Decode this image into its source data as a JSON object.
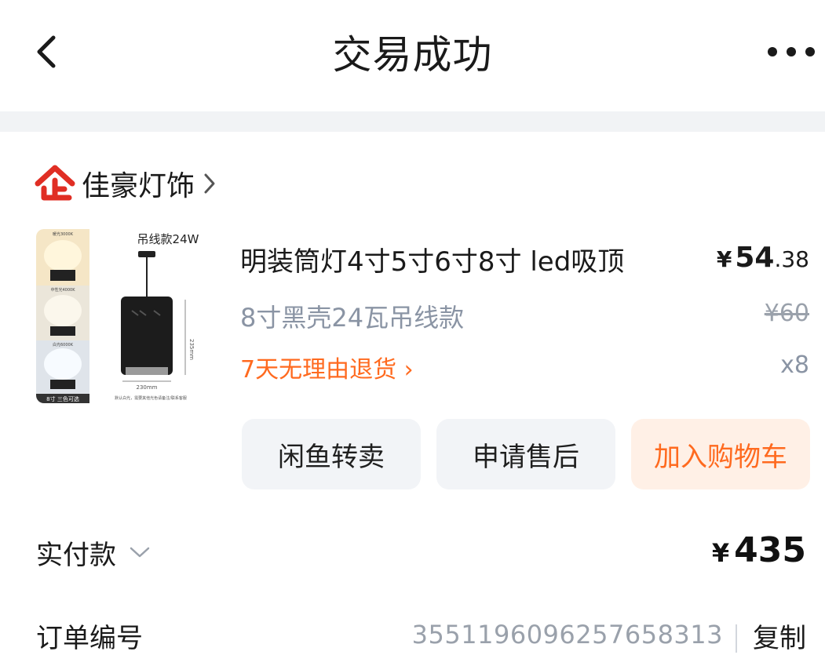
{
  "header": {
    "title": "交易成功",
    "back_icon": "chevron-left-icon",
    "more_icon": "more-horizontal-icon"
  },
  "shop": {
    "name": "佳豪灯饰",
    "logo_icon": "enterprise-badge-icon",
    "logo_color": "#e02e24"
  },
  "product": {
    "title": "明装筒灯4寸5寸6寸8寸 led吸顶",
    "price_symbol": "¥",
    "price_int": "54",
    "price_dec": ".38",
    "spec": "8寸黑壳24瓦吊线款",
    "original_price": "¥60",
    "return_policy": "7天无理由退货 ›",
    "quantity": "x8",
    "image": {
      "label_top": "吊线款24W",
      "swatch_labels": [
        "暖光3000K",
        "中性光4000K",
        "白光6000K"
      ],
      "caption": "8寸 三色可选",
      "dim_width": "230mm",
      "dim_height": "235mm",
      "footnote": "默认白光，需要其他光色请备注/联系客服"
    }
  },
  "actions": {
    "resell": "闲鱼转卖",
    "after_sales": "申请售后",
    "add_cart": "加入购物车"
  },
  "payment": {
    "label": "实付款",
    "symbol": "¥",
    "amount": "435"
  },
  "order": {
    "label": "订单编号",
    "number": "3551196096257658313",
    "copy": "复制"
  },
  "colors": {
    "accent": "#ff6a1f",
    "accent_bg": "#fff0e6",
    "muted": "#8a94a4",
    "button_bg": "#f2f4f7"
  }
}
